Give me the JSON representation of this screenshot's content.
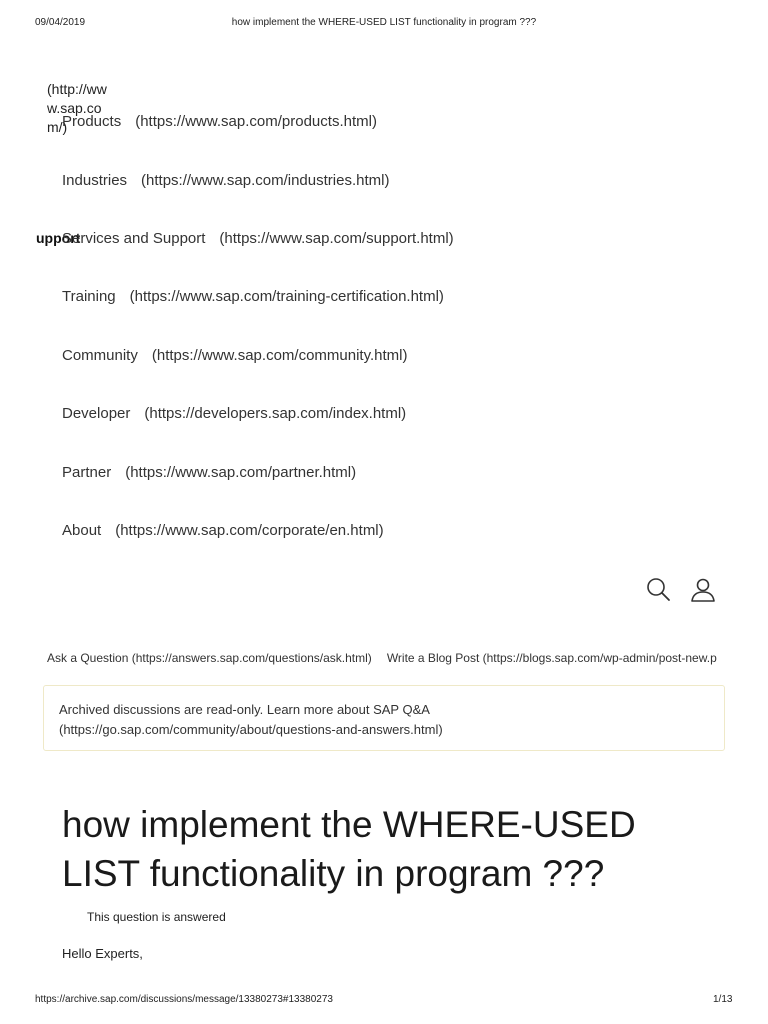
{
  "print_header": {
    "date": "09/04/2019",
    "page_title": "how implement the WHERE-USED LIST functionality in program ???"
  },
  "logo_link": "(http://www.sap.com/)",
  "support_label": "upport",
  "nav": [
    {
      "label": "Products",
      "url": "(https://www.sap.com/products.html)"
    },
    {
      "label": "Industries",
      "url": "(https://www.sap.com/industries.html)"
    },
    {
      "label": "Services and Support",
      "url": "(https://www.sap.com/support.html)"
    },
    {
      "label": "Training",
      "url": "(https://www.sap.com/training-certification.html)"
    },
    {
      "label": "Community",
      "url": "(https://www.sap.com/community.html)"
    },
    {
      "label": "Developer",
      "url": "(https://developers.sap.com/index.html)"
    },
    {
      "label": "Partner",
      "url": "(https://www.sap.com/partner.html)"
    },
    {
      "label": "About",
      "url": "(https://www.sap.com/corporate/en.html)"
    }
  ],
  "icons": {
    "search": "search-icon",
    "user": "user-icon"
  },
  "actions": {
    "ask": "Ask a Question (https://answers.sap.com/questions/ask.html)",
    "blog": "Write a Blog Post (https://blogs.sap.com/wp-admin/post-new.p"
  },
  "notice": {
    "line1": "Archived discussions are read-only. Learn more about SAP Q&A",
    "line2": "(https://go.sap.com/community/about/questions-and-answers.html)"
  },
  "question": {
    "title": "how implement the WHERE-USED LIST functionality in program ???",
    "status": "This question is answered",
    "greeting": "Hello Experts,"
  },
  "print_footer": {
    "url": "https://archive.sap.com/discussions/message/13380273#13380273",
    "page": "1/13"
  }
}
